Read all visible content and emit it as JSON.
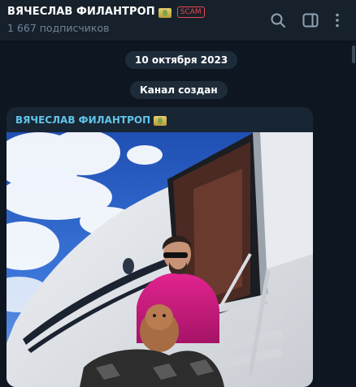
{
  "header": {
    "title": "ВЯЧЕСЛАВ ФИЛАНТРОП",
    "title_emoji": "money-emoji",
    "scam_badge": "SCAM",
    "subscribers": "1 667 подписчиков",
    "icons": [
      "search-icon",
      "sidebar-toggle-icon",
      "more-vertical-icon"
    ]
  },
  "chat": {
    "date_label": "10 октября 2023",
    "service_message": "Канал создан",
    "post": {
      "author": "ВЯЧЕСЛАВ ФИЛАНТРОП",
      "author_emoji": "money-emoji",
      "photo": "photo-man-with-dog-on-private-jet-stairs"
    }
  },
  "colors": {
    "header_bg": "#17212b",
    "chat_bg": "#0e1621",
    "bubble_bg": "#182533",
    "author_name": "#61c4e8",
    "scam_red": "#e5484d",
    "muted_text": "#708499"
  }
}
